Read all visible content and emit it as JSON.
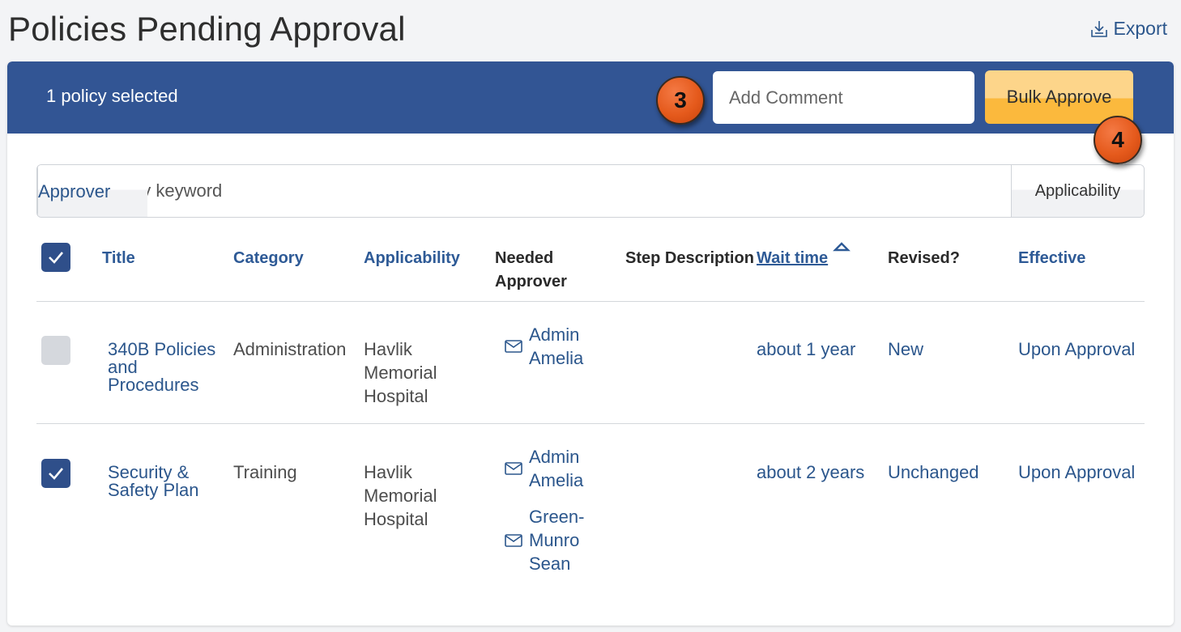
{
  "header": {
    "title": "Policies Pending Approval",
    "export_label": "Export"
  },
  "bulk_bar": {
    "selected_text": "1 policy selected",
    "comment_placeholder": "Add Comment",
    "bulk_approve_label": "Bulk Approve"
  },
  "callouts": [
    "3",
    "4"
  ],
  "filter": {
    "placeholder": "Filter by keyword",
    "approver_label": "Approver",
    "applicability_label": "Applicability"
  },
  "columns": {
    "title": "Title",
    "category": "Category",
    "applicability": "Applicability",
    "needed_approver_1": "Needed",
    "needed_approver_2": "Approver",
    "step_description": "Step Description",
    "wait_time": "Wait time",
    "revised": "Revised?",
    "effective": "Effective"
  },
  "rows": [
    {
      "checked": false,
      "title": [
        "340B Policies",
        "and",
        "Procedures"
      ],
      "category": "Administration",
      "applicability": [
        "Havlik",
        "Memorial",
        "Hospital"
      ],
      "approvers": [
        [
          "Admin",
          "Amelia"
        ]
      ],
      "step_description": "",
      "wait_time": "about 1 year",
      "revised": "New",
      "effective": "Upon Approval"
    },
    {
      "checked": true,
      "title": [
        "Security &",
        "Safety Plan"
      ],
      "category": "Training",
      "applicability": [
        "Havlik",
        "Memorial",
        "Hospital"
      ],
      "approvers": [
        [
          "Admin",
          "Amelia"
        ],
        [
          "Green-",
          "Munro",
          "Sean"
        ]
      ],
      "step_description": "",
      "wait_time": "about 2 years",
      "revised": "Unchanged",
      "effective": "Upon Approval"
    }
  ],
  "colors": {
    "bar": "#325594",
    "link": "#2b568c",
    "accent": "#fbb93d",
    "callout": "#e55a1c"
  },
  "icons": {
    "export": "download-tray-icon",
    "search": "magnifier-icon",
    "check": "checkmark-icon",
    "mail": "envelope-icon",
    "sort": "caret-up-icon"
  }
}
